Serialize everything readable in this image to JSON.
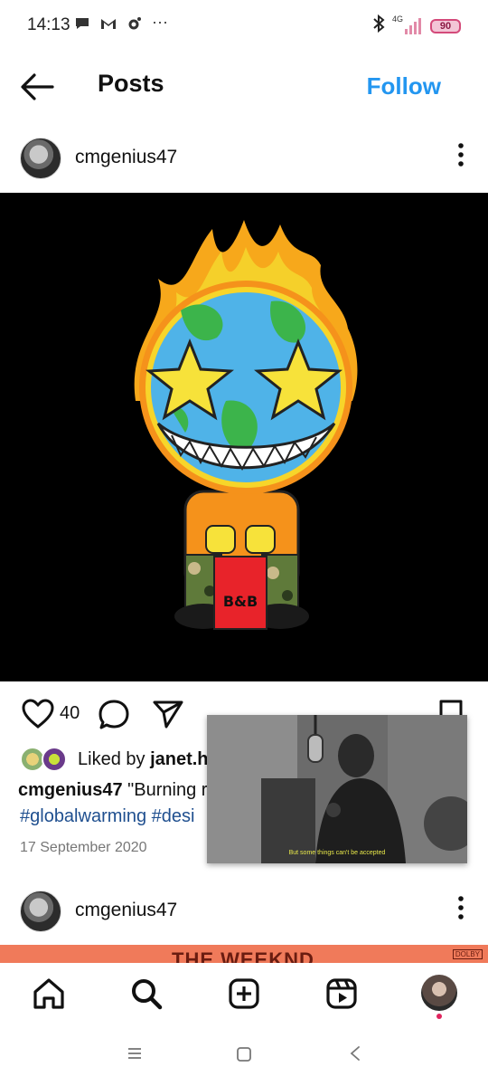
{
  "status_bar": {
    "time": "14:13",
    "left_icons": [
      "chat-bubble-icon",
      "gmail-icon",
      "settings-gear-icon",
      "more-dots-icon"
    ],
    "more_text": "···",
    "network_label": "4G",
    "battery": "90"
  },
  "header": {
    "title": "Posts",
    "follow_label": "Follow"
  },
  "post": {
    "username": "cmgenius47",
    "like_count": "40",
    "liked_by_prefix": "Liked by ",
    "liked_by_name": "janet.h",
    "caption_user": "cmgenius47",
    "caption_text": "\"Burning r",
    "hashtags": "#globalwarming #desi",
    "date": "17 September 2020",
    "image_text": "B&B"
  },
  "pip_video": {
    "subtitle": "But some things can't be accepted"
  },
  "second_post": {
    "username": "cmgenius47",
    "banner_title": "THE WEEKND",
    "banner_badge": "DOLBY"
  },
  "bottom_nav": {
    "items": [
      "home-icon",
      "search-icon",
      "create-icon",
      "reels-icon",
      "profile-avatar"
    ]
  },
  "colors": {
    "follow_blue": "#2396f0",
    "hashtag_blue": "#1f4f8f",
    "notification_red": "#e0245e"
  }
}
